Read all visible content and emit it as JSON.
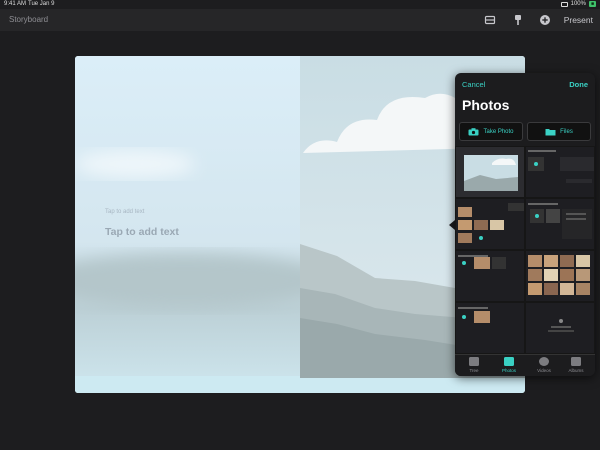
{
  "status_bar": {
    "time": "9:41 AM",
    "date": "Tue Jan 9",
    "battery": "100%"
  },
  "toolbar": {
    "title": "Storyboard",
    "icons": [
      "layout-icon",
      "brush-icon",
      "add-circle-icon"
    ],
    "present_label": "Present"
  },
  "slide": {
    "placeholder_small": "Tap to add text",
    "placeholder_large": "Tap to add text"
  },
  "photos_popover": {
    "cancel_label": "Cancel",
    "done_label": "Done",
    "title": "Photos",
    "take_photo_label": "Take Photo",
    "files_label": "Files",
    "tabs": [
      {
        "label": "Tree",
        "active": false
      },
      {
        "label": "Photos",
        "active": true
      },
      {
        "label": "Videos",
        "active": false
      },
      {
        "label": "Albums",
        "active": false
      }
    ]
  },
  "colors": {
    "accent": "#3ad1c4",
    "background": "#1d1d1f",
    "toolbar": "#262628"
  }
}
